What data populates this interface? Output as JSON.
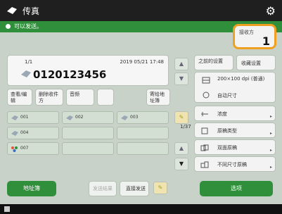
{
  "titlebar": {
    "title": "传真",
    "settings_icon": "gear-icon",
    "logo_icon": "fax-icon"
  },
  "status": {
    "text": "可以发送。",
    "color": "#2f8f3a"
  },
  "copies": {
    "label": "接收方",
    "value": "1"
  },
  "destination": {
    "index": "1/1",
    "timestamp": "2019 05/21 17:48",
    "number": "0120123456"
  },
  "side_buttons": [
    {
      "label": "查看/编辑"
    },
    {
      "label": "删除收件方"
    },
    {
      "label": "音频"
    },
    {
      "label": ""
    },
    {
      "label": "寄给地址簿"
    }
  ],
  "onetouch": {
    "page": "1/37",
    "cells": [
      {
        "label": "001"
      },
      {
        "label": "002"
      },
      {
        "label": "003"
      },
      {
        "label": "004"
      },
      {
        "label": ""
      },
      {
        "label": ""
      },
      {
        "label": "007"
      },
      {
        "label": ""
      },
      {
        "label": ""
      }
    ]
  },
  "right": {
    "call_settings": "之前的设置",
    "favorites": "收藏设置",
    "resolution": "200×100 dpi (普通)",
    "auto_size": "自动尺寸",
    "rows": [
      {
        "label": "浓度",
        "icon": "density-icon"
      },
      {
        "label": "原稿类型",
        "icon": "original-type-icon"
      },
      {
        "label": "双面原稿",
        "icon": "duplex-icon"
      },
      {
        "label": "不同尺寸原稿",
        "icon": "mixed-size-icon"
      }
    ]
  },
  "bottom": {
    "address_book": "地址簿",
    "tx_result": "发送结果",
    "direct_send": "直接发送",
    "start": "选项"
  },
  "accent": "#2f8f3a",
  "highlight": "#f0a020"
}
